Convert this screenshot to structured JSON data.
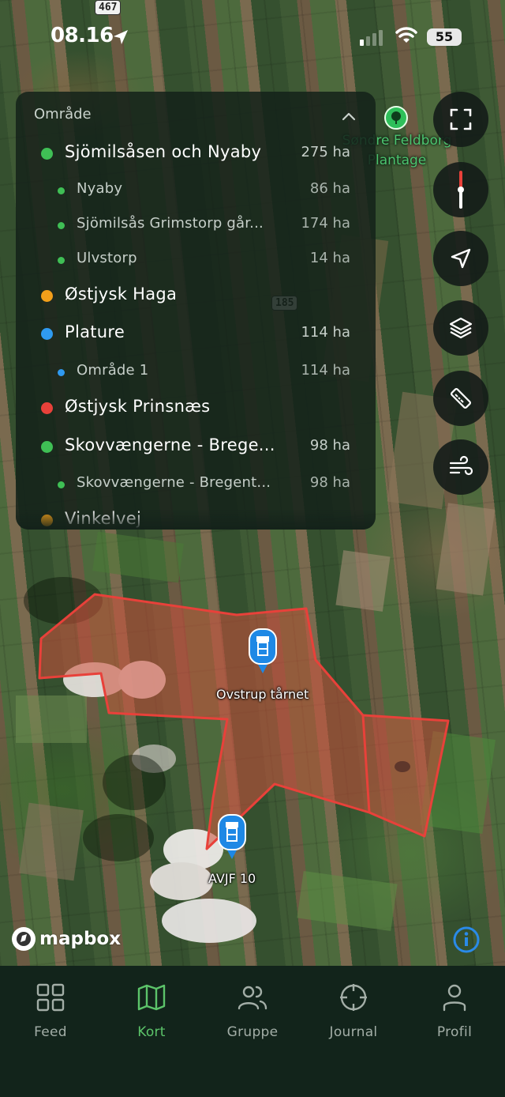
{
  "status_bar": {
    "time": "08.16",
    "battery": "55"
  },
  "road_shields": [
    "467",
    "185"
  ],
  "area_panel": {
    "header": "Område",
    "areas": [
      {
        "name": "Sjömilsåsen och Nyaby",
        "size": "275 ha",
        "color": "#3fbf55",
        "level": "parent"
      },
      {
        "name": "Nyaby",
        "size": "86 ha",
        "color": "#3fbf55",
        "level": "child"
      },
      {
        "name": "Sjömilsås Grimstorp går...",
        "size": "174 ha",
        "color": "#3fbf55",
        "level": "child"
      },
      {
        "name": "Ulvstorp",
        "size": "14 ha",
        "color": "#3fbf55",
        "level": "child"
      },
      {
        "name": "Østjysk Haga",
        "size": "",
        "color": "#f29f1a",
        "level": "parent"
      },
      {
        "name": "Plature",
        "size": "114 ha",
        "color": "#2f9af0",
        "level": "parent"
      },
      {
        "name": "Område 1",
        "size": "114 ha",
        "color": "#2f9af0",
        "level": "child"
      },
      {
        "name": "Østjysk Prinsnæs",
        "size": "",
        "color": "#e8413a",
        "level": "parent"
      },
      {
        "name": "Skovvængerne - Brege...",
        "size": "98 ha",
        "color": "#3fbf55",
        "level": "parent"
      },
      {
        "name": "Skovvængerne - Bregent...",
        "size": "98 ha",
        "color": "#3fbf55",
        "level": "child"
      },
      {
        "name": "Vinkelvej",
        "size": "",
        "color": "#f29f1a",
        "level": "parent"
      }
    ]
  },
  "map_controls": [
    {
      "name": "fullscreen-button",
      "icon": "fullscreen-icon"
    },
    {
      "name": "compass-button",
      "icon": "compass-icon"
    },
    {
      "name": "my-location-button",
      "icon": "location-arrow-icon"
    },
    {
      "name": "layers-button",
      "icon": "layers-icon"
    },
    {
      "name": "measure-button",
      "icon": "ruler-icon"
    },
    {
      "name": "wind-button",
      "icon": "wind-icon"
    }
  ],
  "map": {
    "poi_label_line1": "Søndre Feldborg",
    "poi_label_line2": "Plantage",
    "markers": [
      {
        "label": "Ovstrup tårnet"
      },
      {
        "label": "AVJF 10"
      }
    ],
    "attribution": "mapbox"
  },
  "tabs": [
    {
      "label": "Feed",
      "icon": "grid-icon",
      "active": false
    },
    {
      "label": "Kort",
      "icon": "map-icon",
      "active": true
    },
    {
      "label": "Gruppe",
      "icon": "group-icon",
      "active": false
    },
    {
      "label": "Journal",
      "icon": "crosshair-icon",
      "active": false
    },
    {
      "label": "Profil",
      "icon": "person-icon",
      "active": false
    }
  ],
  "colors": {
    "accent": "#5cc46a",
    "area_outline": "#e8413a",
    "tabbar_bg": "#12241b"
  }
}
